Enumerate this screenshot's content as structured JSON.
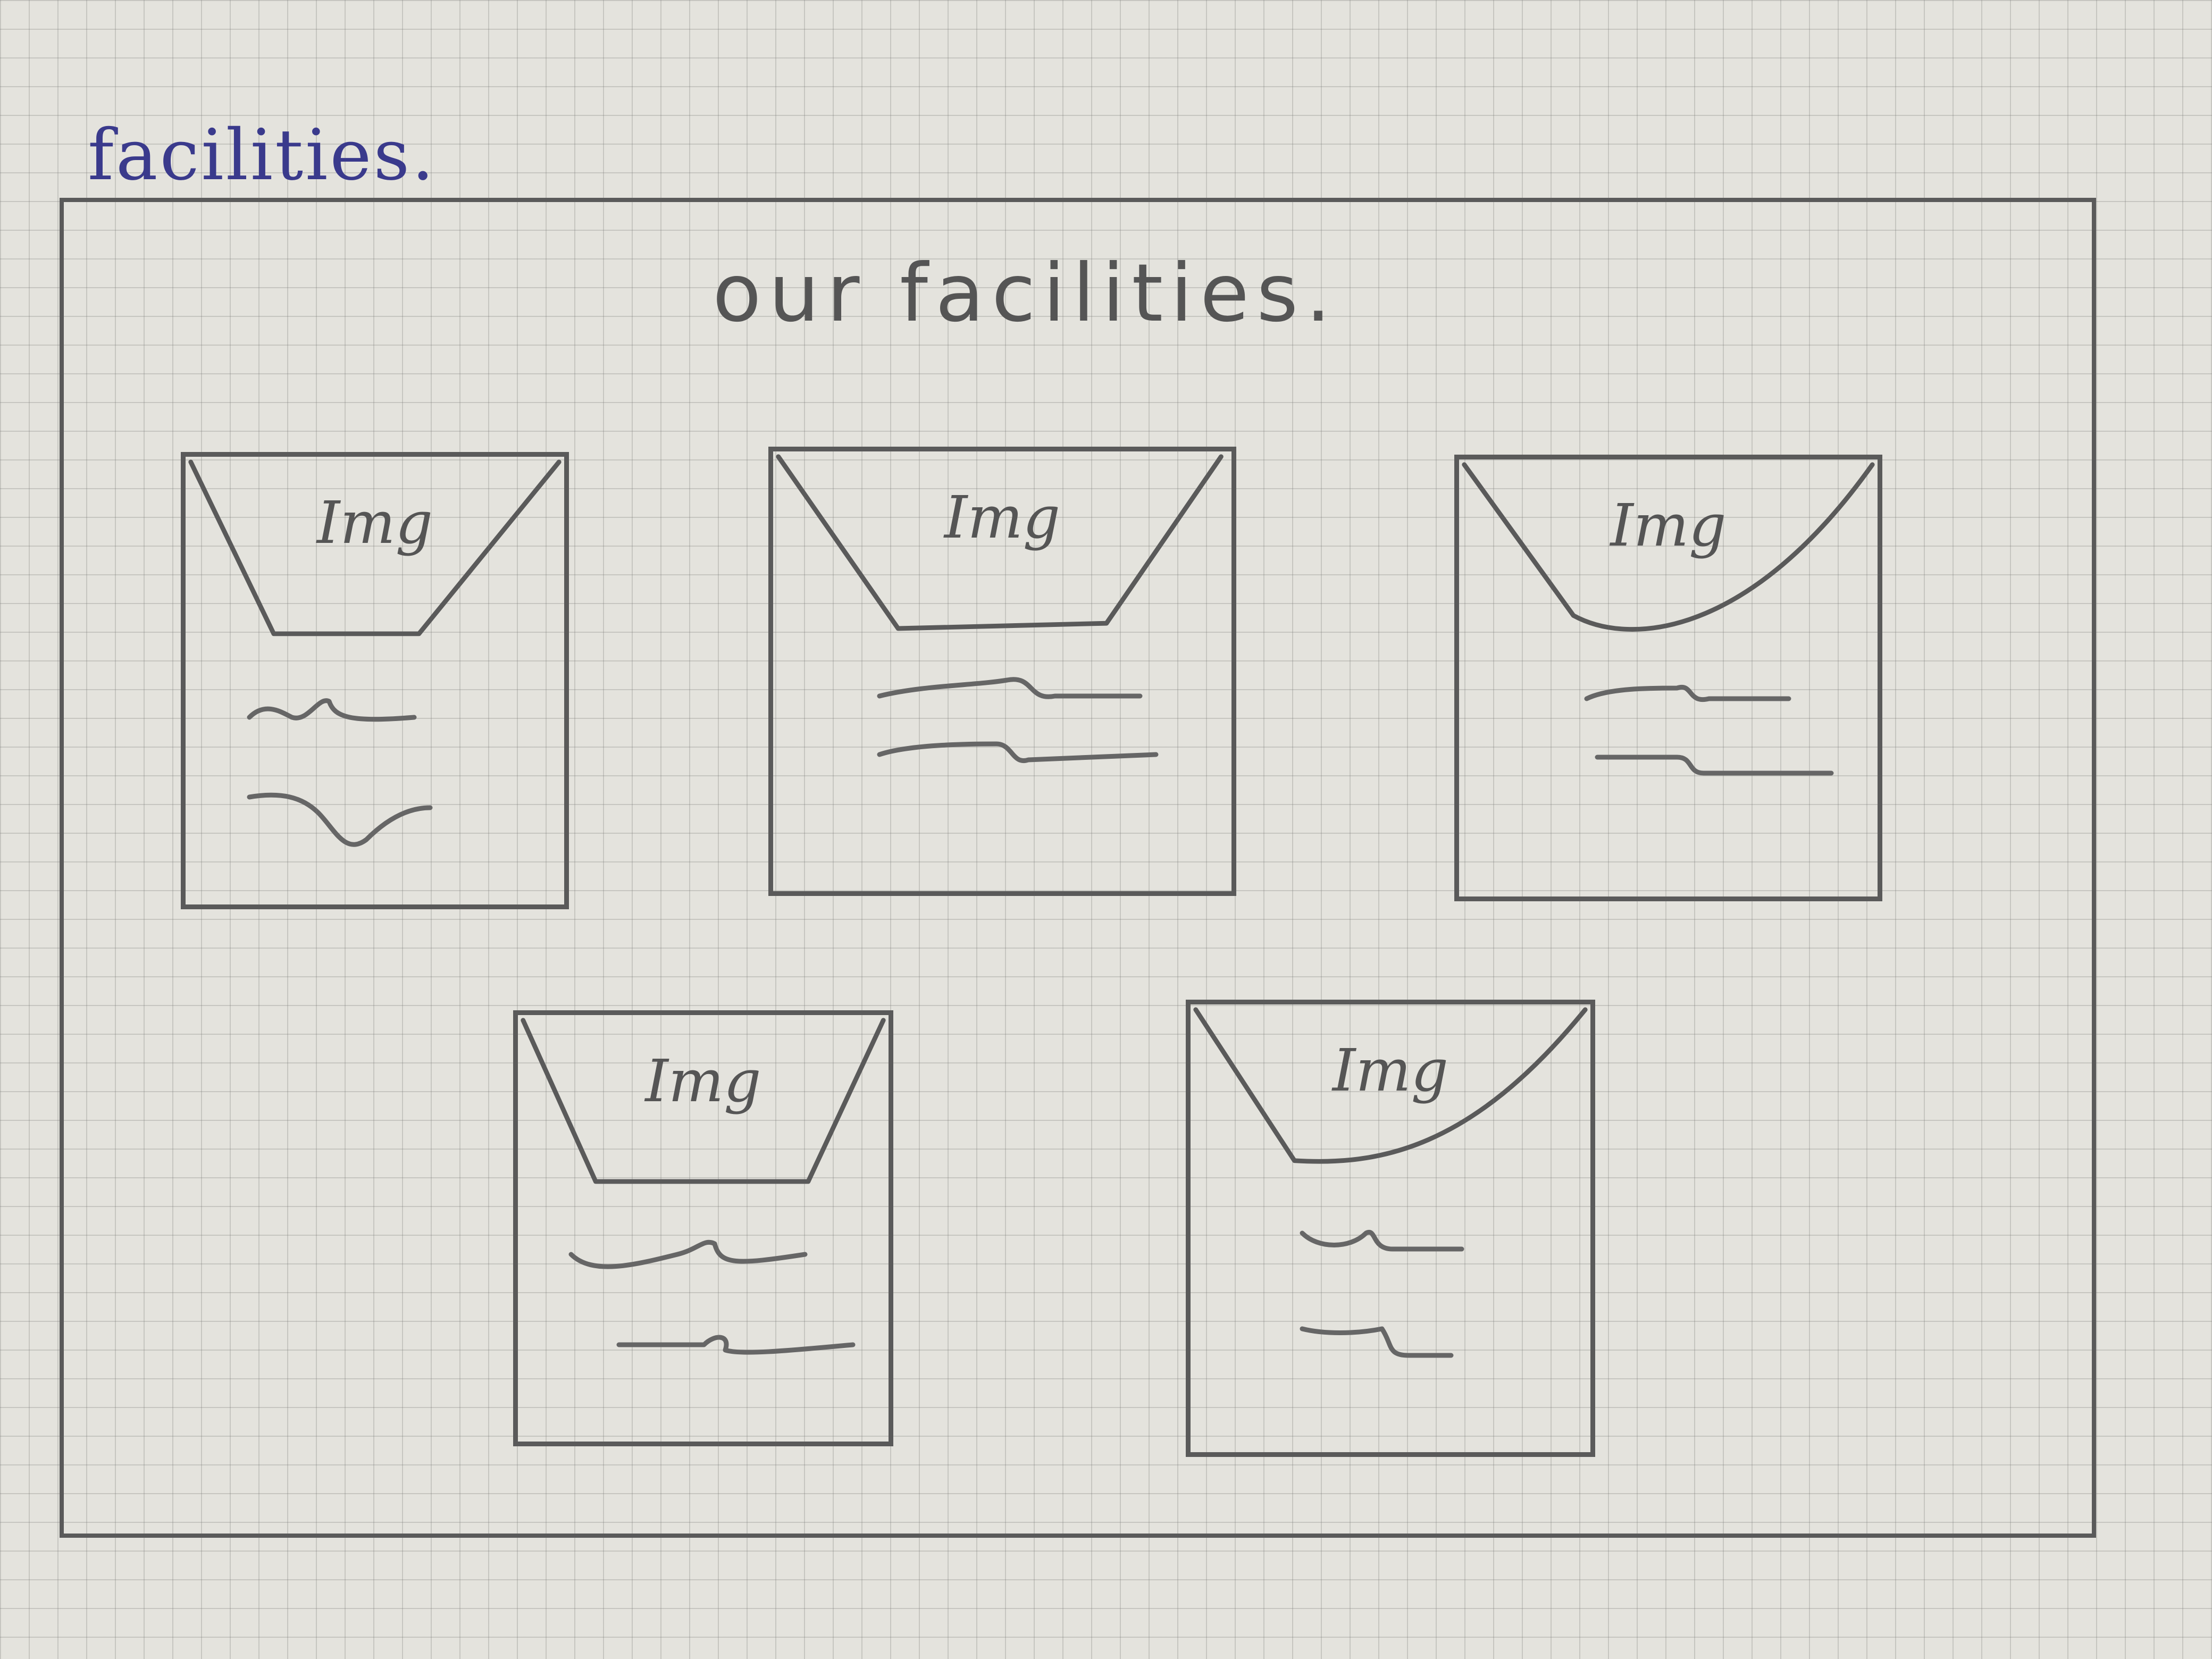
{
  "page_label": "facilities.",
  "section": {
    "heading": "our facilities."
  },
  "cards": [
    {
      "image_label": "Img"
    },
    {
      "image_label": "Img"
    },
    {
      "image_label": "Img"
    },
    {
      "image_label": "Img"
    },
    {
      "image_label": "Img"
    }
  ]
}
